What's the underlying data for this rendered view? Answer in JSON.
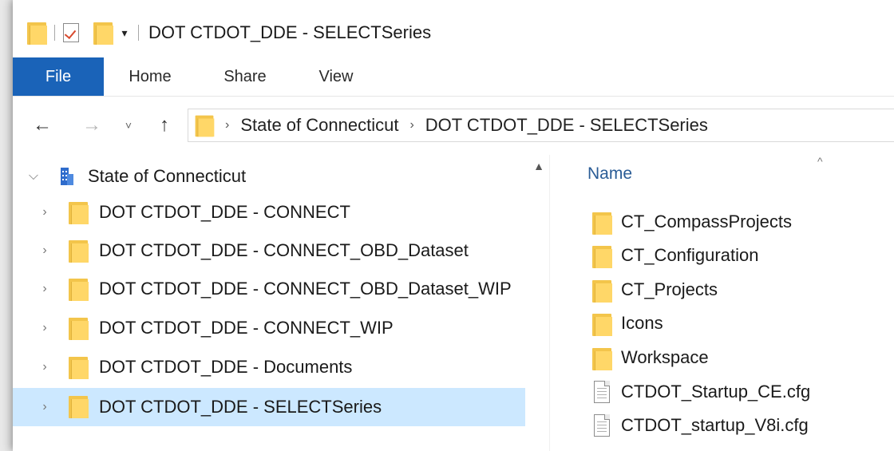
{
  "window": {
    "title": "DOT CTDOT_DDE - SELECTSeries"
  },
  "quick_access": {
    "icons": [
      "folder-icon",
      "properties-icon",
      "new-folder-icon",
      "customize-dropdown-icon"
    ],
    "dropdown_glyph": "▾"
  },
  "ribbon": {
    "tabs": [
      {
        "label": "File",
        "active": true
      },
      {
        "label": "Home"
      },
      {
        "label": "Share"
      },
      {
        "label": "View"
      }
    ],
    "file_color": "#1a63b8"
  },
  "navigation": {
    "back_glyph": "←",
    "forward_glyph": "→",
    "recent_glyph": "˅",
    "up_glyph": "↑"
  },
  "address": {
    "crumbs": [
      "State of Connecticut",
      "DOT CTDOT_DDE - SELECTSeries"
    ],
    "separator": "›"
  },
  "nav_pane": {
    "root": {
      "label": "State of Connecticut",
      "expanded": true,
      "icon": "building-icon"
    },
    "items": [
      {
        "label": "DOT CTDOT_DDE - CONNECT"
      },
      {
        "label": "DOT CTDOT_DDE - CONNECT_OBD_Dataset"
      },
      {
        "label": "DOT CTDOT_DDE - CONNECT_OBD_Dataset_WIP"
      },
      {
        "label": "DOT CTDOT_DDE - CONNECT_WIP"
      },
      {
        "label": "DOT CTDOT_DDE - Documents"
      },
      {
        "label": "DOT CTDOT_DDE - SELECTSeries",
        "selected": true
      }
    ],
    "selected_color": "#cce8ff"
  },
  "content": {
    "column_header": "Name",
    "sort_glyph": "^",
    "files": [
      {
        "name": "CT_CompassProjects",
        "type": "folder"
      },
      {
        "name": "CT_Configuration",
        "type": "folder"
      },
      {
        "name": "CT_Projects",
        "type": "folder"
      },
      {
        "name": "Icons",
        "type": "folder"
      },
      {
        "name": "Workspace",
        "type": "folder"
      },
      {
        "name": "CTDOT_Startup_CE.cfg",
        "type": "file"
      },
      {
        "name": "CTDOT_startup_V8i.cfg",
        "type": "file"
      }
    ]
  }
}
